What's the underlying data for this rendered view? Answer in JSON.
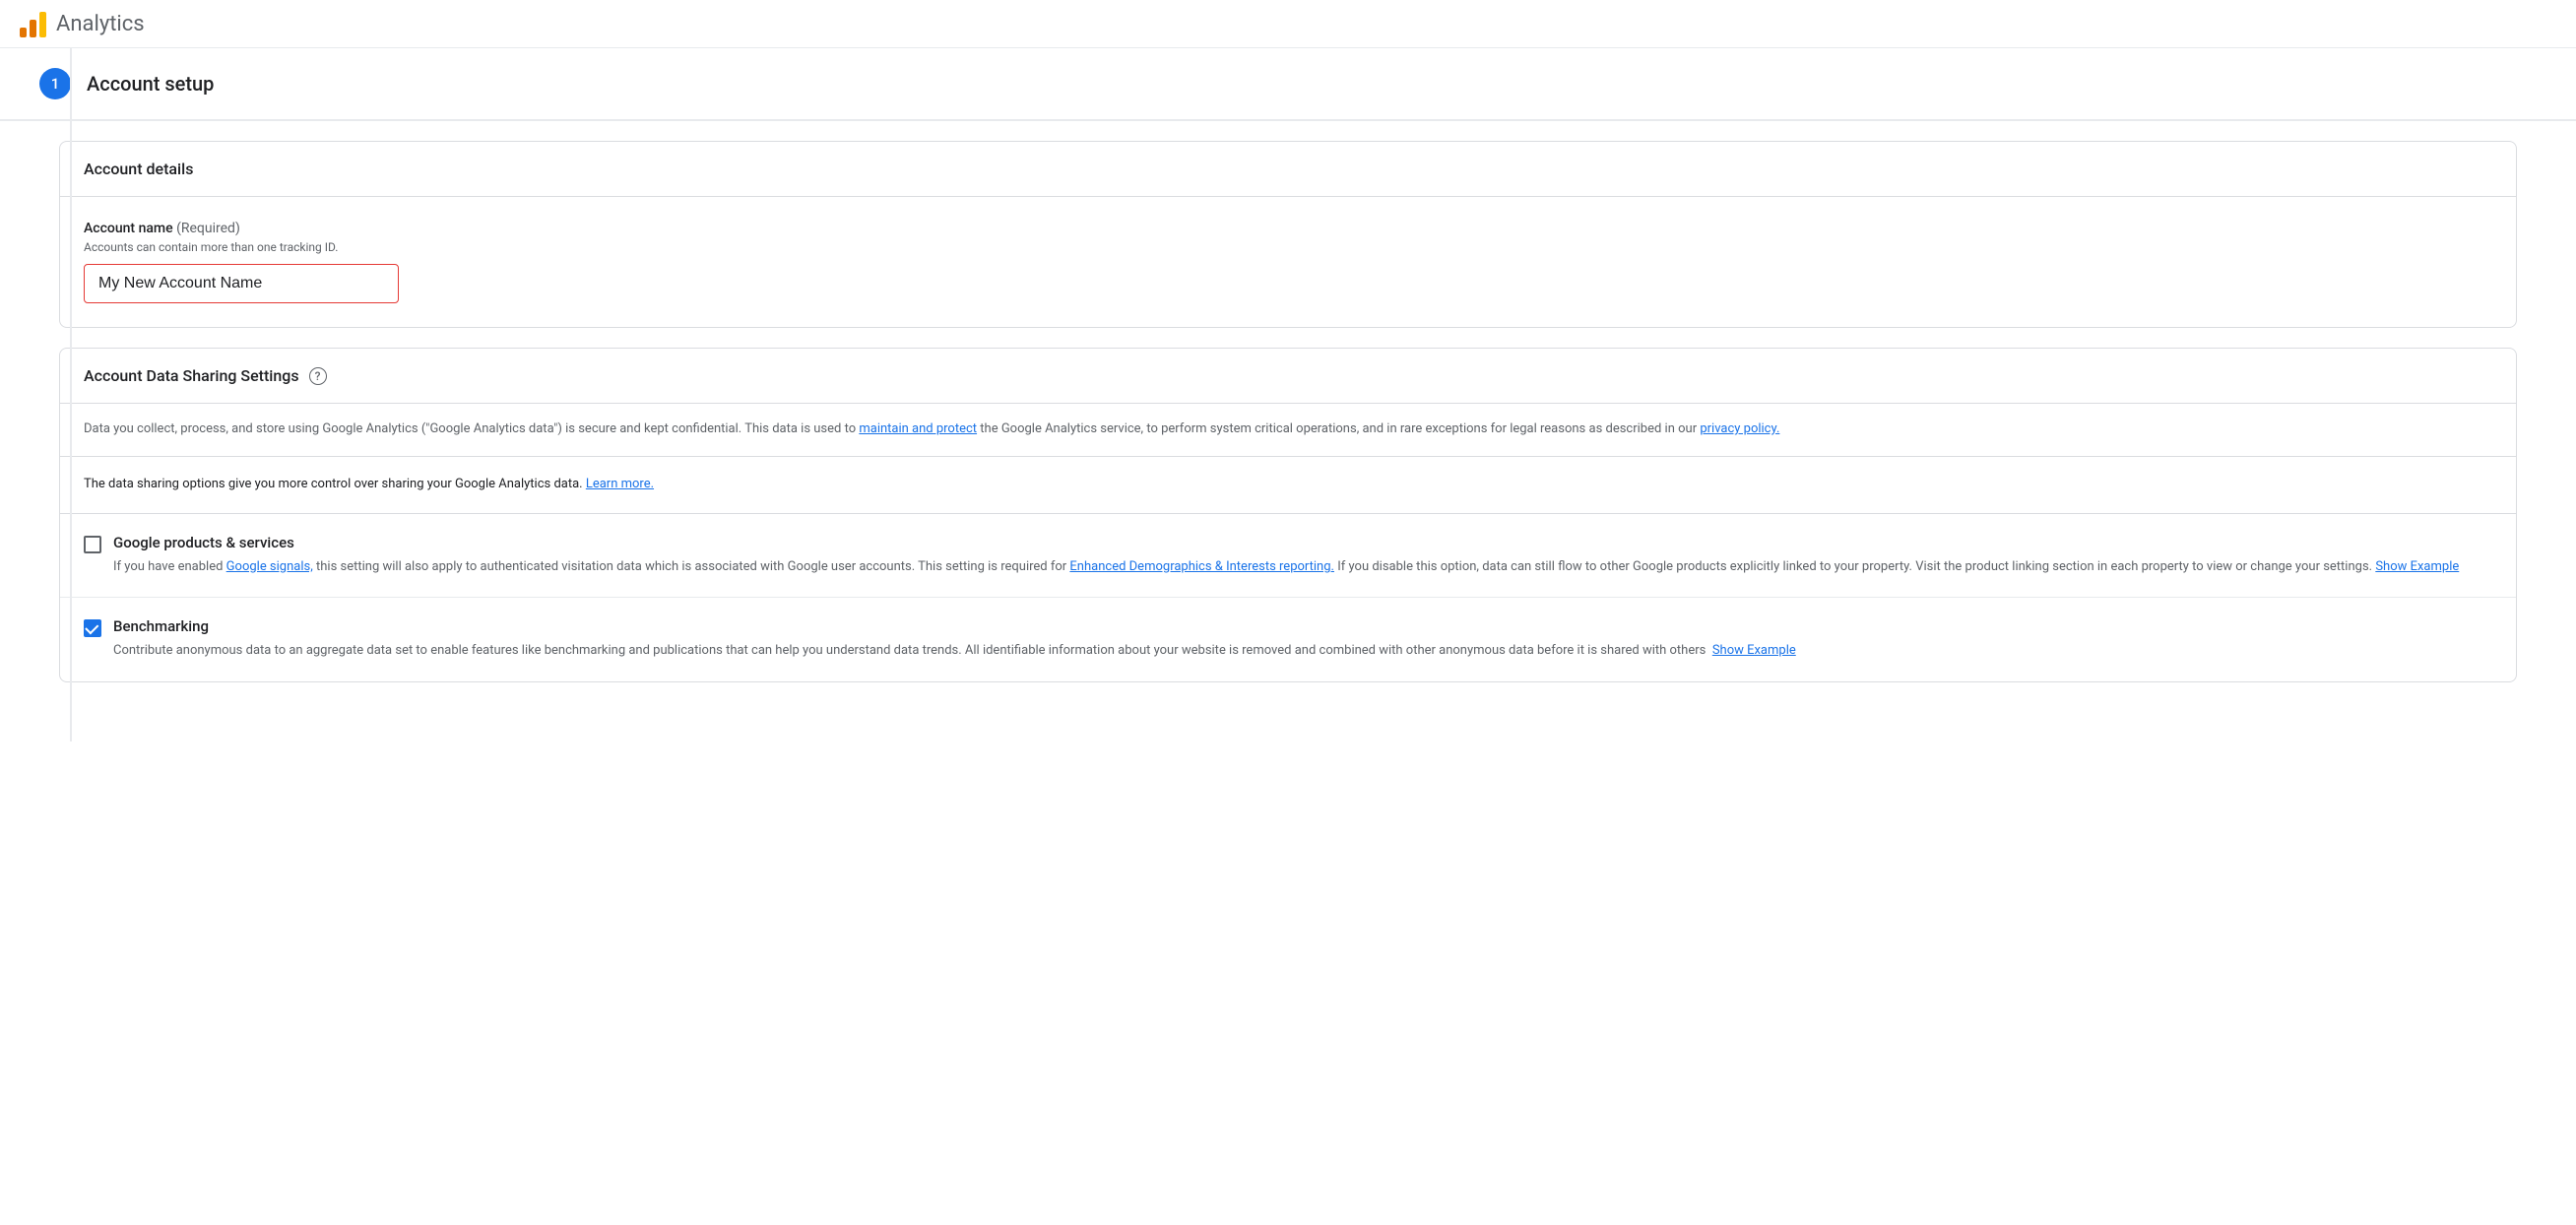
{
  "header": {
    "app_name": "Analytics",
    "logo_alt": "Google Analytics logo"
  },
  "step": {
    "number": "1",
    "title": "Account setup"
  },
  "account_details": {
    "card_title": "Account details",
    "field_label": "Account name",
    "field_required": "(Required)",
    "field_hint": "Accounts can contain more than one tracking ID.",
    "field_value": "My New Account Name"
  },
  "data_sharing": {
    "card_title": "Account Data Sharing Settings",
    "help_icon": "?",
    "description": "Data you collect, process, and store using Google Analytics (\"Google Analytics data\") is secure and kept confidential. This data is used to ",
    "description_link1_text": "maintain and protect",
    "description_link1_href": "#",
    "description_after_link1": " the Google Analytics service, to perform system critical operations, and in rare exceptions for legal reasons as described in our ",
    "description_link2_text": "privacy policy.",
    "description_link2_href": "#",
    "intro_text": "The data sharing options give you more control over sharing your Google Analytics data. ",
    "intro_link_text": "Learn more.",
    "intro_link_href": "#",
    "checkboxes": [
      {
        "id": "google-products",
        "label": "Google products & services",
        "checked": false,
        "description_parts": [
          {
            "type": "text",
            "value": "If you have enabled "
          },
          {
            "type": "link",
            "text": "Google signals,",
            "href": "#"
          },
          {
            "type": "text",
            "value": " this setting will also apply to authenticated visitation data which is associated with Google user accounts. This setting is required for "
          },
          {
            "type": "link",
            "text": "Enhanced Demographics & Interests reporting.",
            "href": "#"
          },
          {
            "type": "text",
            "value": " If you disable this option, data can still flow to other Google products explicitly linked to your property. Visit the product linking section in each property to view or change your settings. "
          },
          {
            "type": "link",
            "text": "Show Example",
            "href": "#"
          }
        ]
      },
      {
        "id": "benchmarking",
        "label": "Benchmarking",
        "checked": true,
        "description_parts": [
          {
            "type": "text",
            "value": "Contribute anonymous data to an aggregate data set to enable features like benchmarking and publications that can help you understand data trends. All identifiable information about your website is removed and combined with other anonymous data before it is shared with others  "
          },
          {
            "type": "link",
            "text": "Show Example",
            "href": "#"
          }
        ]
      }
    ]
  }
}
